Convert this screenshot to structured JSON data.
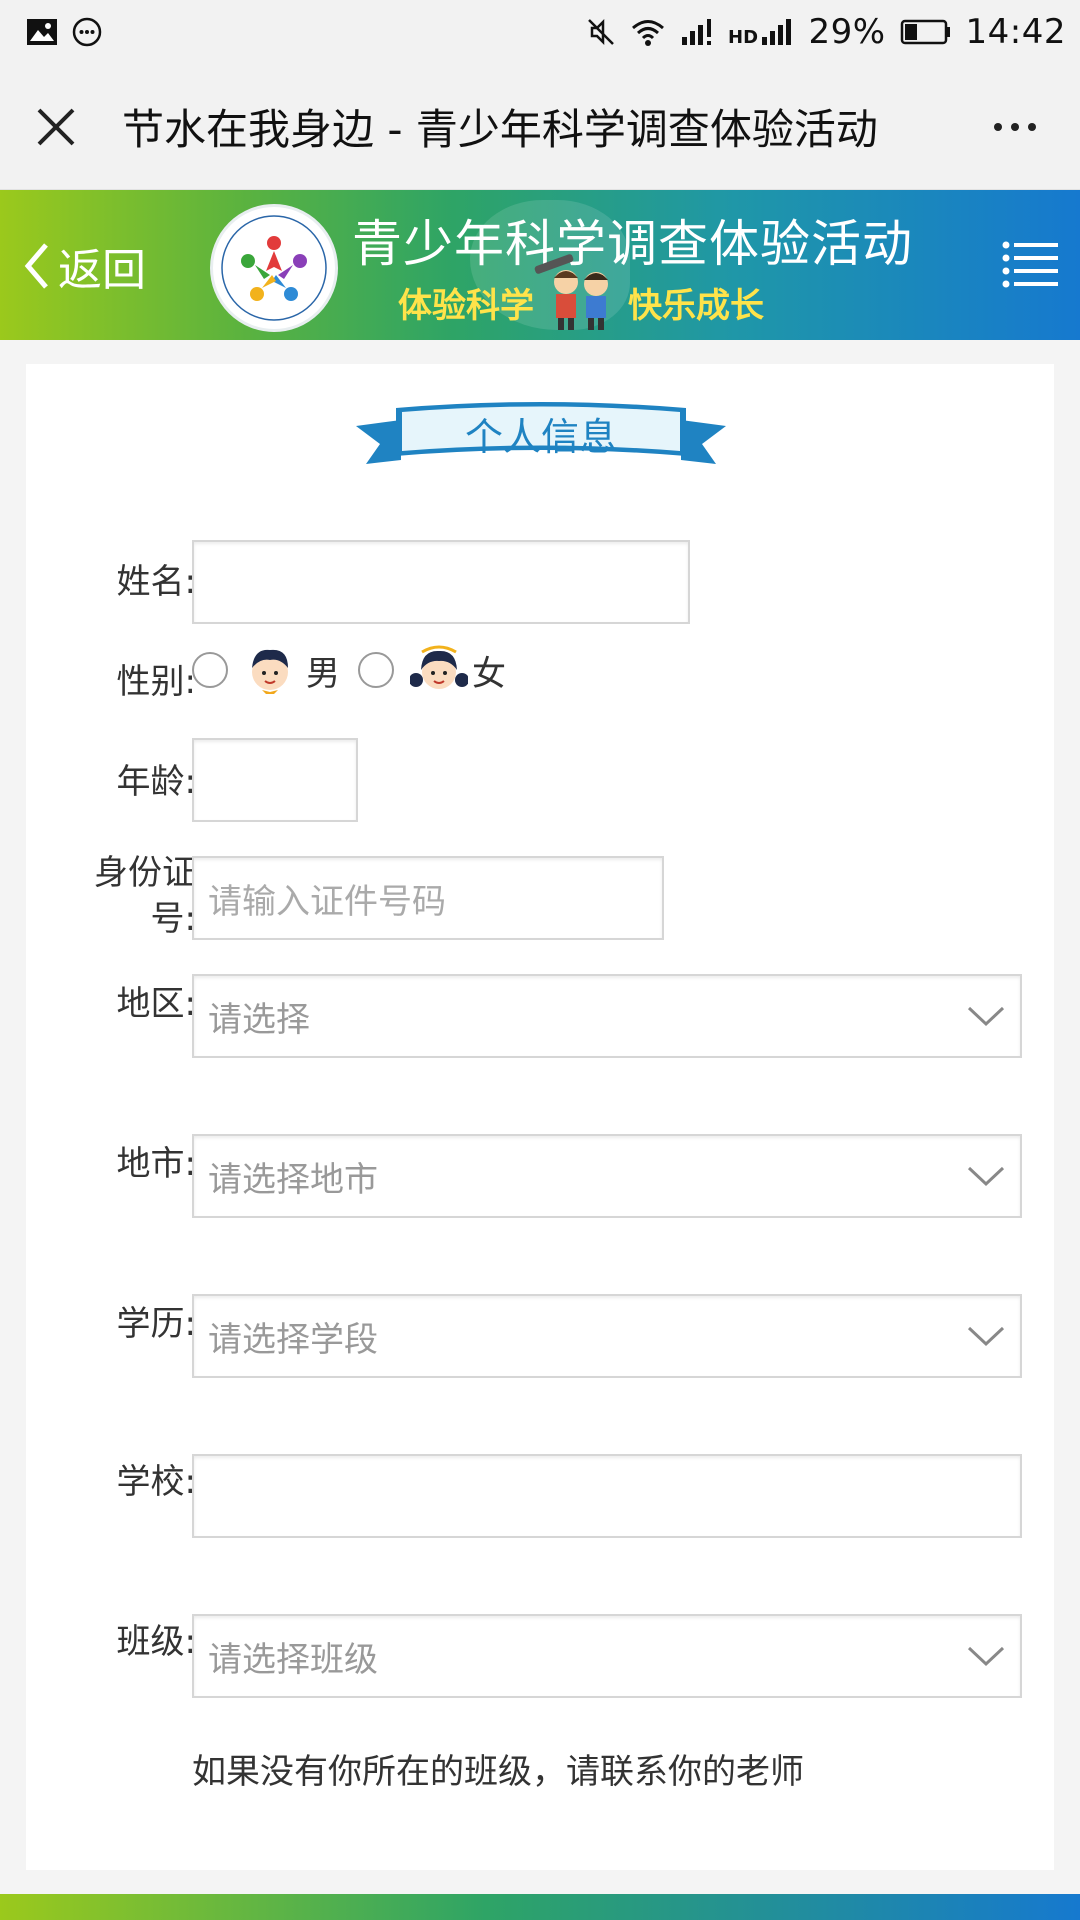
{
  "status_bar": {
    "battery_text": "29%",
    "time": "14:42"
  },
  "browser": {
    "title": "节水在我身边 - 青少年科学调查体验活动"
  },
  "banner": {
    "back_label": "返回",
    "title": "青少年科学调查体验活动",
    "slogan_left": "体验科学",
    "slogan_right": "快乐成长",
    "logo_url_text": "www.sciencedaa.org.cn"
  },
  "form": {
    "section_title": "个人信息",
    "name_label": "姓名:",
    "gender_label": "性别:",
    "gender_male": "男",
    "gender_female": "女",
    "age_label": "年龄:",
    "id_label_line1": "身份证",
    "id_label_line2": "号:",
    "id_placeholder": "请输入证件号码",
    "region_label": "地区:",
    "region_value": "请选择",
    "city_label": "地市:",
    "city_value": "请选择地市",
    "education_label": "学历:",
    "education_value": "请选择学段",
    "school_label": "学校:",
    "class_label": "班级:",
    "class_value": "请选择班级",
    "note": "如果没有你所在的班级，请联系你的老师"
  },
  "colors": {
    "accent_blue": "#1f83c2",
    "banner_green": "#5cb33e",
    "banner_blue": "#1679cf"
  }
}
